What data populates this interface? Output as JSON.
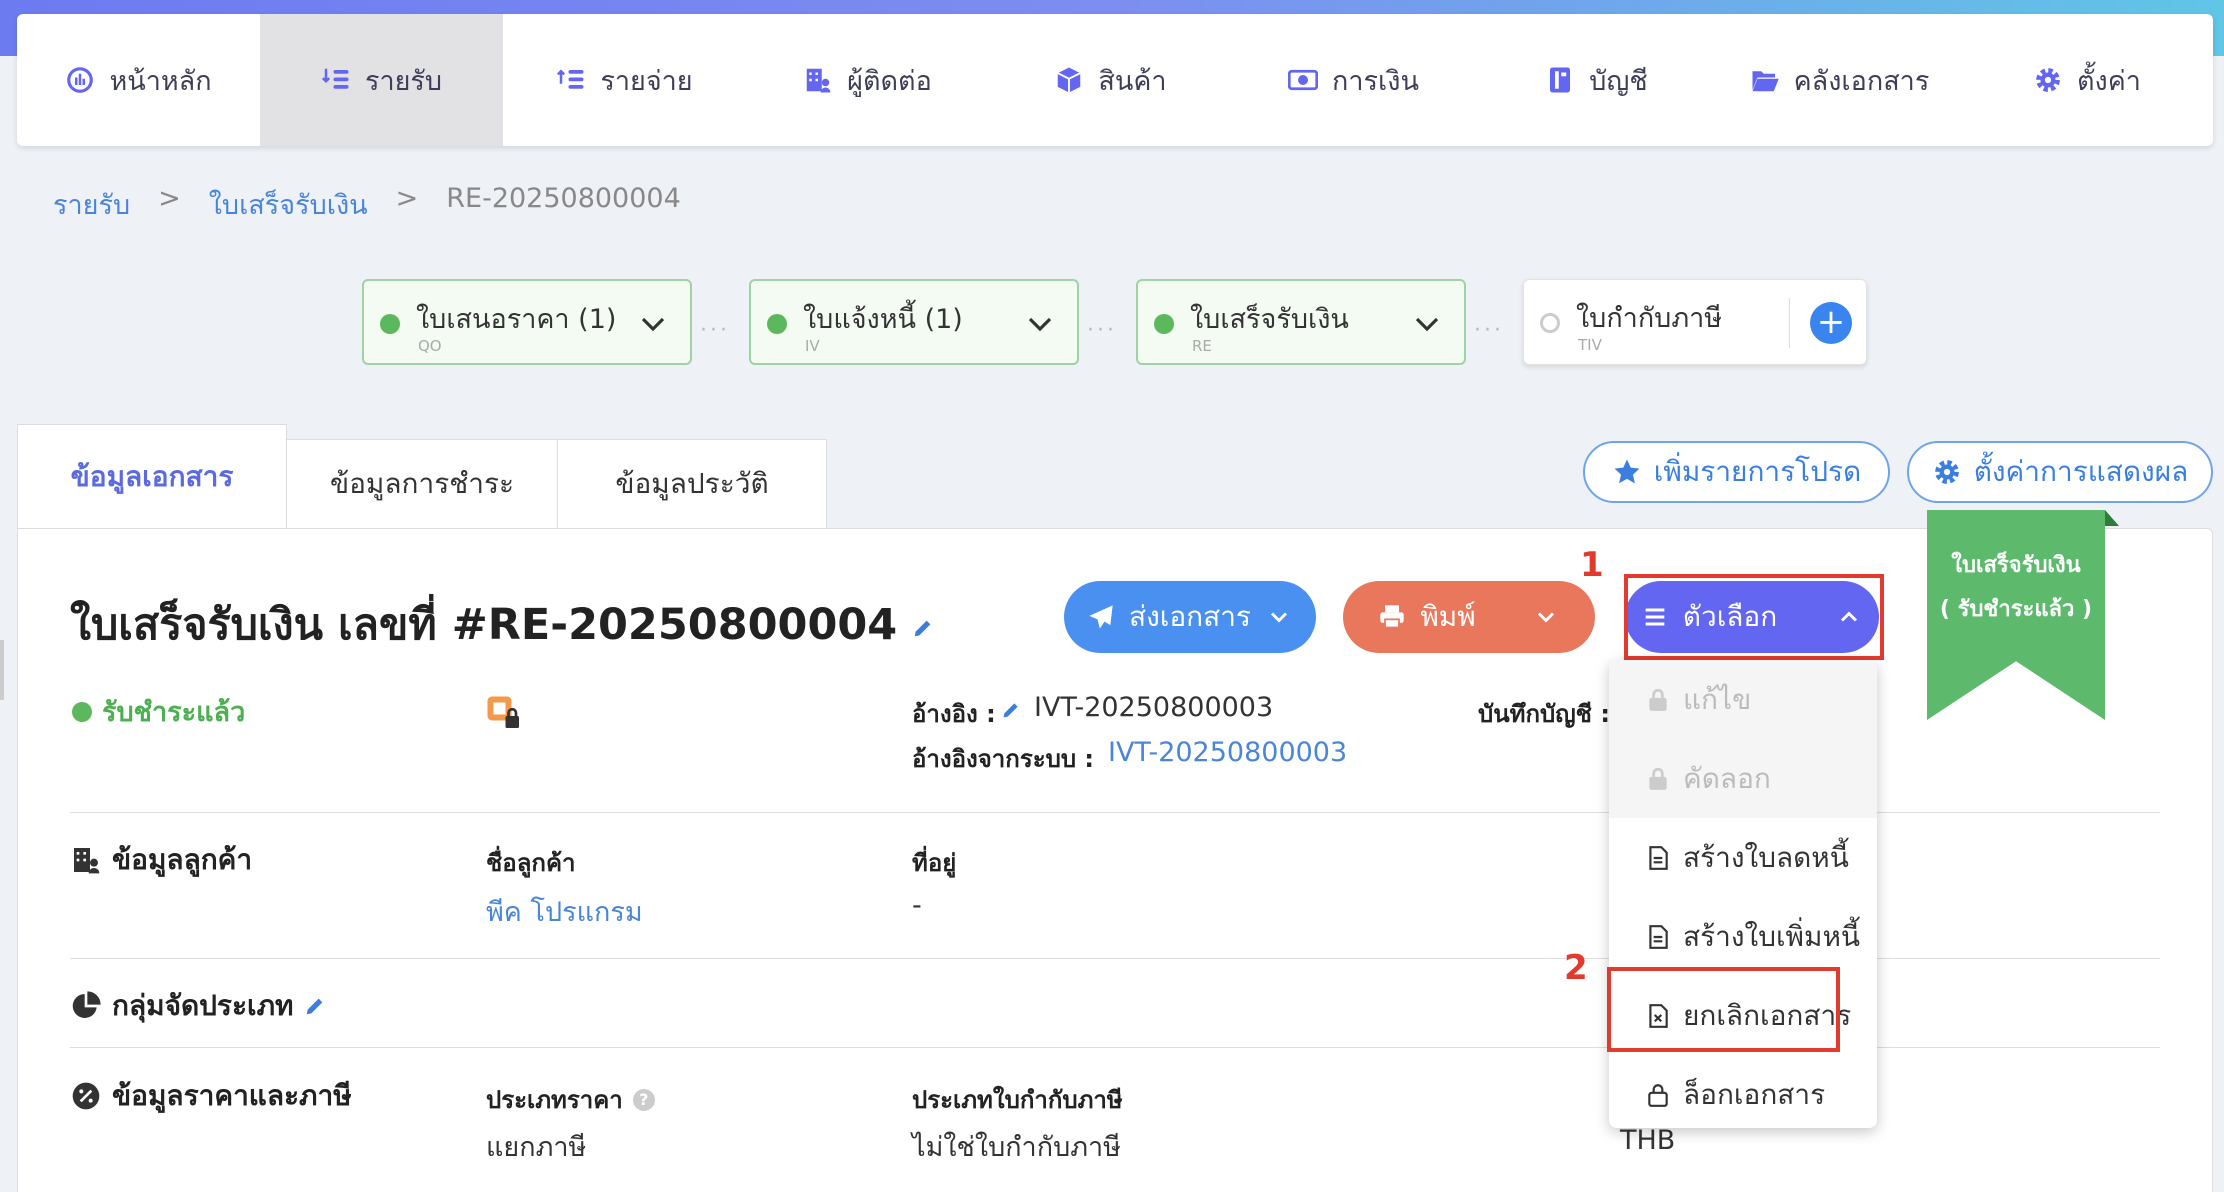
{
  "nav": {
    "items": [
      {
        "label": "หน้าหลัก",
        "icon": "dashboard-icon"
      },
      {
        "label": "รายรับ",
        "icon": "coins-in-icon",
        "active": true
      },
      {
        "label": "รายจ่าย",
        "icon": "coins-out-icon"
      },
      {
        "label": "ผู้ติดต่อ",
        "icon": "contacts-building-icon"
      },
      {
        "label": "สินค้า",
        "icon": "box-icon"
      },
      {
        "label": "การเงิน",
        "icon": "money-icon"
      },
      {
        "label": "บัญชี",
        "icon": "ledger-book-icon"
      },
      {
        "label": "คลังเอกสาร",
        "icon": "folder-open-icon"
      },
      {
        "label": "ตั้งค่า",
        "icon": "gear-icon"
      }
    ]
  },
  "breadcrumb": {
    "root": "รายรับ",
    "sep1": ">",
    "section": "ใบเสร็จรับเงิน",
    "sep2": ">",
    "current": "RE-20250800004"
  },
  "flow": [
    {
      "title": "ใบเสนอราคา (1)",
      "code": "QO",
      "status": "done"
    },
    {
      "title": "ใบแจ้งหนี้ (1)",
      "code": "IV",
      "status": "done"
    },
    {
      "title": "ใบเสร็จรับเงิน",
      "code": "RE",
      "status": "done"
    },
    {
      "title": "ใบกำกับภาษี",
      "code": "TIV",
      "status": "pending"
    }
  ],
  "flow_add_symbol": "+",
  "tabs": [
    "ข้อมูลเอกสาร",
    "ข้อมูลการชำระ",
    "ข้อมูลประวัติ"
  ],
  "pills": {
    "favorite": "เพิ่มรายการโปรด",
    "display": "ตั้งค่าการแสดงผล"
  },
  "doc": {
    "title": "ใบเสร็จรับเงิน เลขที่ #RE-20250800004",
    "status": "รับชำระแล้ว"
  },
  "buttons": {
    "send": "ส่งเอกสาร",
    "print": "พิมพ์",
    "options": "ตัวเลือก"
  },
  "steps": {
    "one": "1",
    "two": "2"
  },
  "ribbon": {
    "line1": "ใบเสร็จรับเงิน",
    "line2": "( รับชำระแล้ว )"
  },
  "dropdown": [
    {
      "label": "แก้ไข",
      "icon": "lock-icon",
      "disabled": true
    },
    {
      "label": "คัดลอก",
      "icon": "lock-icon",
      "disabled": true
    },
    {
      "label": "สร้างใบลดหนี้",
      "icon": "document-icon"
    },
    {
      "label": "สร้างใบเพิ่มหนี้",
      "icon": "document-icon"
    },
    {
      "label": "ยกเลิกเอกสาร",
      "icon": "document-x-icon"
    },
    {
      "label": "ล็อกเอกสาร",
      "icon": "lock-outline-icon"
    }
  ],
  "reference": {
    "ref_label": "อ้างอิง :",
    "ref_value": "IVT-20250800003",
    "sys_label": "อ้างอิงจากระบบ :",
    "sys_value": "IVT-20250800003",
    "account_label": "บันทึกบัญชี :"
  },
  "customer": {
    "section": "ข้อมูลลูกค้า",
    "name_label": "ชื่อลูกค้า",
    "name_value": "พีค โปรแกรม",
    "address_label": "ที่อยู่",
    "address_value": "-"
  },
  "category": {
    "section": "กลุ่มจัดประเภท"
  },
  "pricing": {
    "section": "ข้อมูลราคาและภาษี",
    "price_type_label": "ประเภทราคา",
    "price_type_value": "แยกภาษี",
    "tax_invoice_label": "ประเภทใบกำกับภาษี",
    "tax_invoice_value": "ไม่ใช่ใบกำกับภาษี",
    "currency_value": "THB"
  },
  "colors": {
    "accent": "#6366f1",
    "send": "#4a90f0",
    "print": "#e8775c",
    "options": "#6366f1",
    "ribbon": "#5dba6c",
    "highlight": "#e23b2e"
  }
}
